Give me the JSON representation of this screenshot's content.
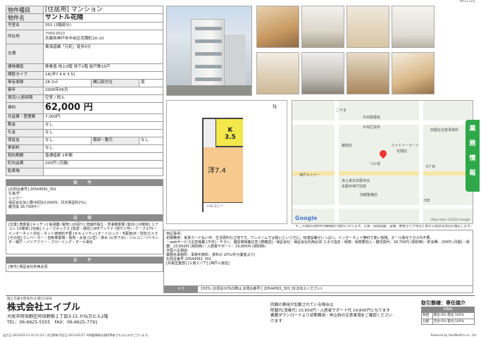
{
  "page_id": "4611101",
  "spec": {
    "type_label": "物件種目",
    "type_value": "[住居用] マンション",
    "name_label": "物件名",
    "name_value": "サントル花隈",
    "room_label": "号室名",
    "room_value": "301 (3階部分)",
    "location_label": "所在地",
    "postal": "〒650-0013",
    "address": "兵庫県神戸市中央区花隈町20-10",
    "transport_label": "交通",
    "transport_value": "東海道線「元町」徒歩5分",
    "structure_label": "建物構造",
    "structure_value": "鉄骨造 地上5階 地下1階 総戸数15戸",
    "layout_label": "間取タイプ",
    "layout_value": "1K[洋7.4 K 3.5]",
    "area_label": "専有面積",
    "area_value": "28.3㎡",
    "opening_label": "開口部方位",
    "opening_value": "南",
    "built_label": "築年",
    "built_value": "2006年06月",
    "status_label": "現況/入居時期",
    "status_value": "空室 / 即入",
    "rent_label": "賃料",
    "rent_value": "62,000 円",
    "mgmt_label": "共益費・管理費",
    "mgmt_value": "7,000円",
    "deposit_label": "敷金",
    "deposit_value": "なし",
    "keymoney_label": "礼金",
    "keymoney_value": "なし",
    "hoshou_label": "保証金",
    "hoshou_value": "なし",
    "shokyaku_label": "償却・敷引",
    "shokyaku_value": "なし",
    "renewal_label": "更新料",
    "renewal_value": "なし",
    "contract_label": "契約期間",
    "contract_value": "普通借家 2年間",
    "townfee_label": "町内会費",
    "townfee_value": "200円 (月額)",
    "parking_label": "駐車場",
    "parking_value": ""
  },
  "bikou": {
    "title": "備 考",
    "text": "[お問合番号] 20544581_301\n礼金/IT\nシャワー\n保証会社加入要(初回10,000円、月次保証料2%)。\n鍵交換 18,700円～"
  },
  "setsubi": {
    "title": "設 備",
    "text": "[位置] 角部屋 [キッチン] 給湯器 (電気) [水回り] 洗面所独立・洗濯機置場 (室内) [冷暖房] エアコン (冷暖房) [収納] シューズボックス [放送・通信] UHFアンテナ (地デジ可)・ケーブルTV・インターネット対応・ネット使用料不要 [セキュリティ] オートロック・宅配BOX・防犯カメラ [その他] エレベーター・自転車置場・電気・水道 (公営)・排水 (公共下水)・バルコニー/ベランダ・網戸・バリアフリー・フローリング・オール電化"
  },
  "jouken": {
    "title": "条 件",
    "text": "[条件] 保証会社利用必須"
  },
  "floorplan": {
    "k_label": "K",
    "k_size": "3.5",
    "room_label": "洋7.4",
    "balcony_label": "バルコニー",
    "compass": "N"
  },
  "map": {
    "labels": [
      "こやま",
      "中央図書館",
      "中央区役所",
      "雑餉店",
      "ファミリーマート",
      "花隈店",
      "神戸セミナー",
      "浄土真宗本願寺派",
      "本願寺神戸別院",
      "加藤整備店",
      "つか道",
      "6丁目",
      "元町",
      "田園在住者事務所"
    ],
    "google": "Google",
    "copyright": "Map data ©2020 Google"
  },
  "side_tab": [
    "業",
    "務",
    "情",
    "報"
  ],
  "photo_note": "※ この資料は物件の概略紹介資料になります。写真、間取図面、設備、敷金などが現況と異なる場合は現況を優先します。",
  "remarks": {
    "title": "特記事項：",
    "text": "初期費用：家賃カード払い可、生活便利な立地です。ワンルームでは狭いという方に。快適設備がいっぱい。インターネット無料で使い放題。オール電化でガス代不要。\n・webサービス広告掲載 [不可]・チラシ、雑誌等掲載広告 [要確認]・保証会社：保証会社利用必須 エポス指定・保険：保険要加入・鍵交換代：18,700円 (契約時)・町会費：200円 (月額)・除菌：23,650円 (契約時)・入居者サポート：19,800円 (契約時)\n外国人応相談\n業務名事務所：事務手数料：賃料の 25%(件分業者より)\nお問合番号 20544581_301\n[共募営業部] [三宮エリア] [神戸三宮店]"
  },
  "ad": {
    "label": "ＡＤ",
    "value": "150% (お問合せ代の際は お問合番号 [ 20544581_301 ]をお伝えください)"
  },
  "footer": {
    "license": "国土交通大臣免許(4)第5338号",
    "company": "株式会社エイブル",
    "address": "大阪市阿倍野区阿倍野筋１丁目3-15 かね万ビル2階",
    "tel": "TEL：06-6625-5555　FAX：06-6625-7791",
    "note": "同額の費用が記載されている場合は\n除菌代(消毒代) 23,650円・入居者サポート代 19,800円となります\n書類ダウンロードより初期費用・申込時の注意事項をご確認ください\nけます",
    "mode_title": "取引態様：専任媒介",
    "fee_header": "手数料",
    "fee_row1_label": "負担",
    "fee_row1_value": "貸主:0% 借主:100%",
    "fee_row2_label": "分配",
    "fee_row2_value": "元付:0% 客付:100%"
  },
  "bottom": {
    "left": "出力日:2023/02/13 10:12:24 / 次回更新予定日:2023/02/27 ※掲載情報は随時更新されるものがございます。",
    "right": "Powered by RealNetPro co., ltd."
  }
}
